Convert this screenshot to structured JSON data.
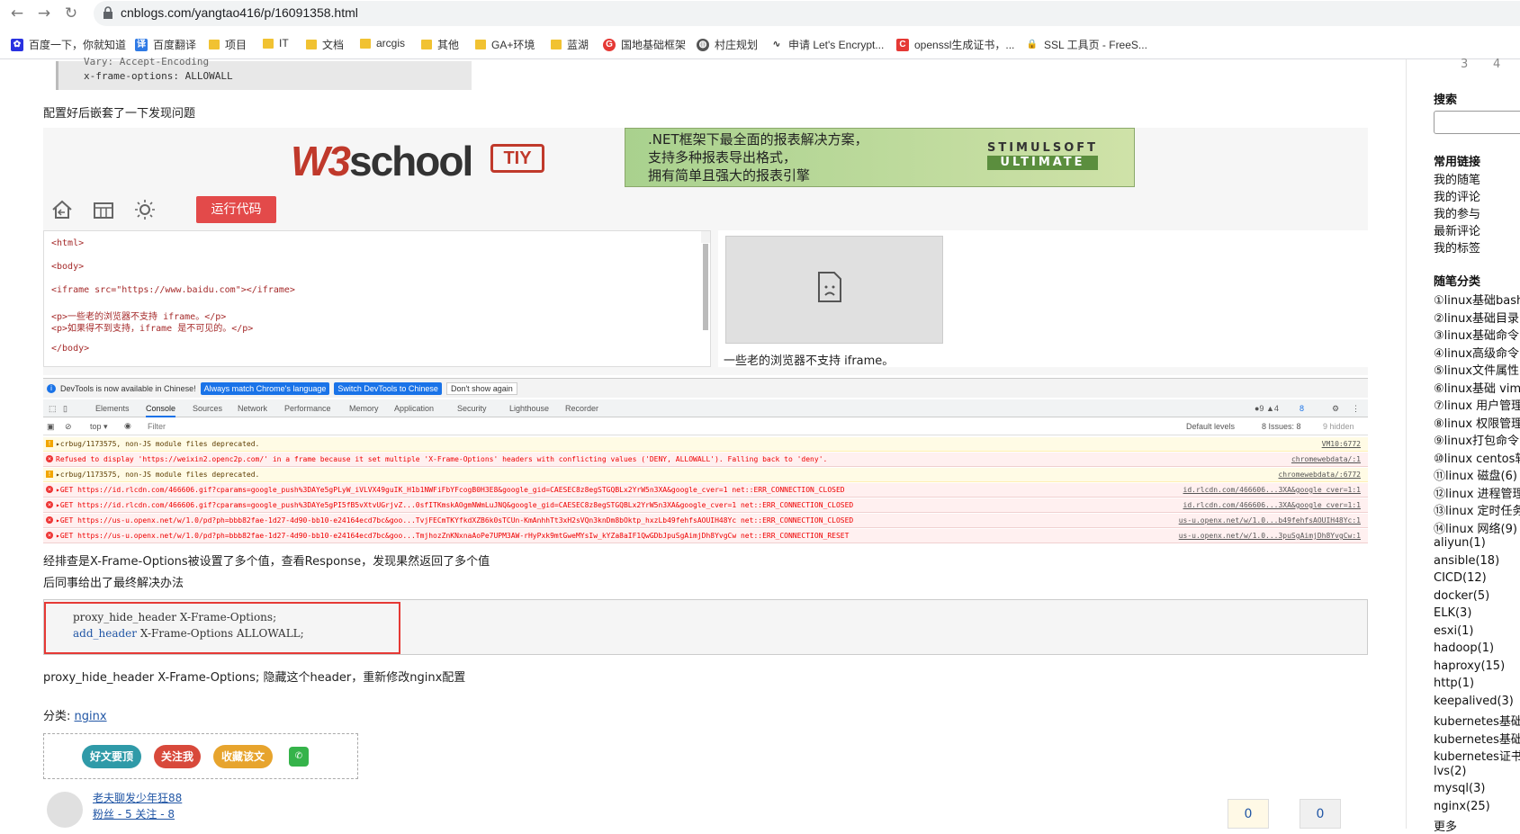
{
  "browser": {
    "url": "cnblogs.com/yangtao416/p/16091358.html",
    "bookmarks": [
      {
        "label": "百度一下，你就知道",
        "icon": "baidu-icon"
      },
      {
        "label": "百度翻译",
        "icon": "translate-icon"
      },
      {
        "label": "项目",
        "icon": "folder-icon"
      },
      {
        "label": "IT",
        "icon": "folder-icon"
      },
      {
        "label": "文档",
        "icon": "folder-icon"
      },
      {
        "label": "arcgis",
        "icon": "folder-icon"
      },
      {
        "label": "其他",
        "icon": "folder-icon"
      },
      {
        "label": "GA+环境",
        "icon": "folder-icon"
      },
      {
        "label": "蓝湖",
        "icon": "folder-icon"
      },
      {
        "label": "国地基础框架",
        "icon": "site-icon"
      },
      {
        "label": "村庄规划",
        "icon": "globe-icon"
      },
      {
        "label": "申请 Let's Encrypt...",
        "icon": "letsencrypt-icon"
      },
      {
        "label": "openssl生成证书，...",
        "icon": "csdn-icon"
      },
      {
        "label": "SSL 工具页 - FreeS...",
        "icon": "lock-icon"
      }
    ]
  },
  "article": {
    "header_lines": [
      "Vary: Accept-Encoding",
      "x-frame-options: ALLOWALL"
    ],
    "p1": "配置好后嵌套了一下发现问题",
    "w3": {
      "logo": "W3school",
      "tiy": "TIY",
      "ad_lines": [
        ".NET框架下最全面的报表解决方案，",
        "支持多种报表导出格式，",
        "拥有简单且强大的报表引擎"
      ],
      "ad_brand": "STIMULSOFT",
      "ad_brand2": "ULTIMATE",
      "run_label": "运行代码",
      "code_lines": [
        "<html>",
        "",
        "<body>",
        "",
        "<iframe src=\"https://www.baidu.com\"></iframe>",
        "",
        "<p>一些老的浏览器不支持 iframe。</p>",
        "<p>如果得不到支持，iframe 是不可见的。</p>",
        "",
        "</body>"
      ],
      "preview_text": "一些老的浏览器不支持 iframe。"
    },
    "devtools": {
      "banner": "DevTools is now available in Chinese!",
      "btn_match": "Always match Chrome's language",
      "btn_switch": "Switch DevTools to Chinese",
      "btn_dont": "Don't show again",
      "tabs": [
        "Elements",
        "Console",
        "Sources",
        "Network",
        "Performance",
        "Memory",
        "Application",
        "Security",
        "Lighthouse",
        "Recorder"
      ],
      "badges": "●9 ▲4",
      "badge_msgs": "8",
      "context": "top",
      "filter_placeholder": "Filter",
      "levels": "Default levels",
      "issues": "8 Issues: 8",
      "hidden": "9 hidden",
      "rows": [
        {
          "type": "warn",
          "msg": "▸crbug/1173575, non-JS module files deprecated.",
          "src": "VM10:6772"
        },
        {
          "type": "err",
          "msg": "Refused to display 'https://weixin2.openc2p.com/' in a frame because it set multiple 'X-Frame-Options' headers with conflicting values ('DENY, ALLOWALL'). Falling back to 'deny'.",
          "src": "chromewebdata/:1"
        },
        {
          "type": "warn",
          "msg": "▸crbug/1173575, non-JS module files deprecated.",
          "src": "chromewebdata/:6772"
        },
        {
          "type": "err",
          "msg": "▸GET https://id.rlcdn.com/466606.gif?cparams=google_push%3DAYe5gPLyW_iVLVX49guIK_H1b1NWFiFbYFcogB0H3E8&google_gid=CAESEC8z8egSTGQBLx2YrW5n3XA&google_cver=1 net::ERR_CONNECTION_CLOSED",
          "src": "id.rlcdn.com/466606...3XA&google_cver=1:1"
        },
        {
          "type": "err",
          "msg": "▸GET https://id.rlcdn.com/466606.gif?cparams=google_push%3DAYe5gPI5fB5vXtvUGrjvZ...0sfITKmskAOgmNWmLuJNQ&google_gid=CAESEC8z8egSTGQBLx2YrW5n3XA&google_cver=1 net::ERR_CONNECTION_CLOSED",
          "src": "id.rlcdn.com/466606...3XA&google_cver=1:1"
        },
        {
          "type": "err",
          "msg": "▸GET https://us-u.openx.net/w/1.0/pd?ph=bbb82fae-1d27-4d90-bb10-e24164ecd7bc&goo...TvjFECmTKYfkdXZB6k0sTCUn-KmAnhhTt3xH2sVQn3knDm8bOktp_hxzLb49fehfsAOUIH48Yc net::ERR_CONNECTION_CLOSED",
          "src": "us-u.openx.net/w/1.0...b49fehfsAOUIH48Yc:1"
        },
        {
          "type": "err",
          "msg": "▸GET https://us-u.openx.net/w/1.0/pd?ph=bbb82fae-1d27-4d90-bb10-e24164ecd7bc&goo...TmjhozZnKNxnaAoPe7UPM3AW-rHyPxk9mtGweMYsIw_kYZa8aIF1QwGDbJpuSgAimjDh8YvgCw net::ERR_CONNECTION_RESET",
          "src": "us-u.openx.net/w/1.0...3puSgAimjDh8YvgCw:1"
        }
      ]
    },
    "p2": "经排查是X-Frame-Options被设置了多个值，查看Response，发现果然返回了多个值",
    "p3": "后同事给出了最终解决办法",
    "code": {
      "line1": "proxy_hide_header X-Frame-Options;",
      "line2_kw": "add_header",
      "line2_rest": " X-Frame-Options ALLOWALL;"
    },
    "p4": "proxy_hide_header X-Frame-Options; 隐藏这个header，重新修改nginx配置",
    "category_label": "分类: ",
    "category_link": "nginx",
    "buttons": [
      "好文要顶",
      "关注我",
      "收藏该文"
    ],
    "author": "老夫聊发少年狂88",
    "follow": "粉丝 - 5 关注 - 8",
    "digg": "0",
    "bury": "0"
  },
  "sidebar": {
    "calendar_nums": [
      "3",
      "4"
    ],
    "search_title": "搜索",
    "links_title": "常用链接",
    "links": [
      "我的随笔",
      "我的评论",
      "我的参与",
      "最新评论",
      "我的标签"
    ],
    "cat_title": "随笔分类",
    "cats": [
      "①linux基础bash",
      "②linux基础目录",
      "③linux基础命令",
      "④linux高级命令",
      "⑤linux文件属性",
      "⑥linux基础 vim",
      "⑦linux 用户管理",
      "⑧linux 权限管理",
      "⑨linux打包命令",
      "⑩linux centos软",
      "⑪linux 磁盘(6)",
      "⑫linux 进程管理",
      "⑬linux 定时任务",
      "⑭linux 网络(9)",
      "aliyun(1)",
      "ansible(18)",
      "CICD(12)",
      "docker(5)",
      "ELK(3)",
      "esxi(1)",
      "hadoop(1)",
      "haproxy(15)",
      "http(1)",
      "keepalived(3)",
      "kubernetes基础",
      "kubernetes基础",
      "kubernetes证书",
      "lvs(2)",
      "mysql(3)",
      "nginx(25)",
      "更多"
    ]
  }
}
